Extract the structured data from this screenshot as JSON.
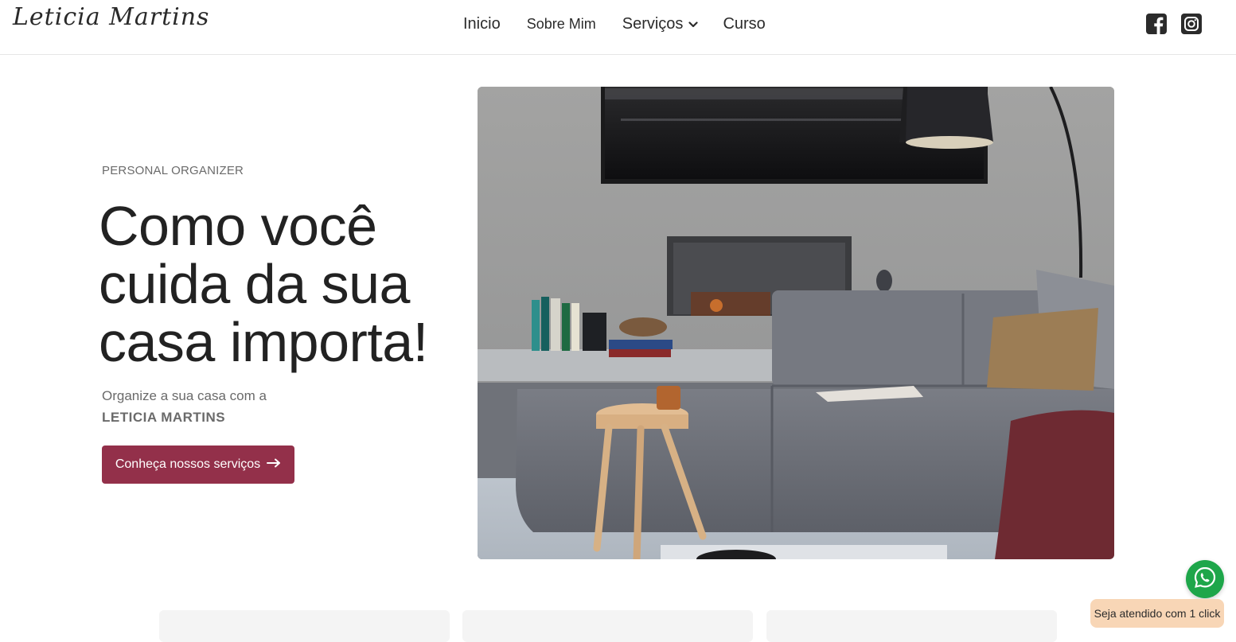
{
  "header": {
    "logo_text": "Leticia Martins",
    "nav": [
      {
        "label": "Inicio"
      },
      {
        "label": "Sobre Mim"
      },
      {
        "label": "Serviços"
      },
      {
        "label": "Curso"
      }
    ],
    "social": [
      "facebook-icon",
      "instagram-icon"
    ]
  },
  "hero": {
    "eyebrow": "PERSONAL ORGANIZER",
    "headline_line1": "Como você",
    "headline_line2": "cuida da sua",
    "headline_line3": "casa importa!",
    "sub_line1": "Organize a sua casa com a",
    "sub_line2": "LETICIA MARTINS",
    "cta_label": "Conheça nossos serviços",
    "image_icon": "living-room-photo"
  },
  "whatsapp": {
    "label": "Seja atendido com 1 click",
    "icon": "whatsapp-icon"
  },
  "colors": {
    "accent": "#93304a",
    "whatsapp": "#1ea64a",
    "whatsapp_label_bg": "#f8d6b6"
  }
}
